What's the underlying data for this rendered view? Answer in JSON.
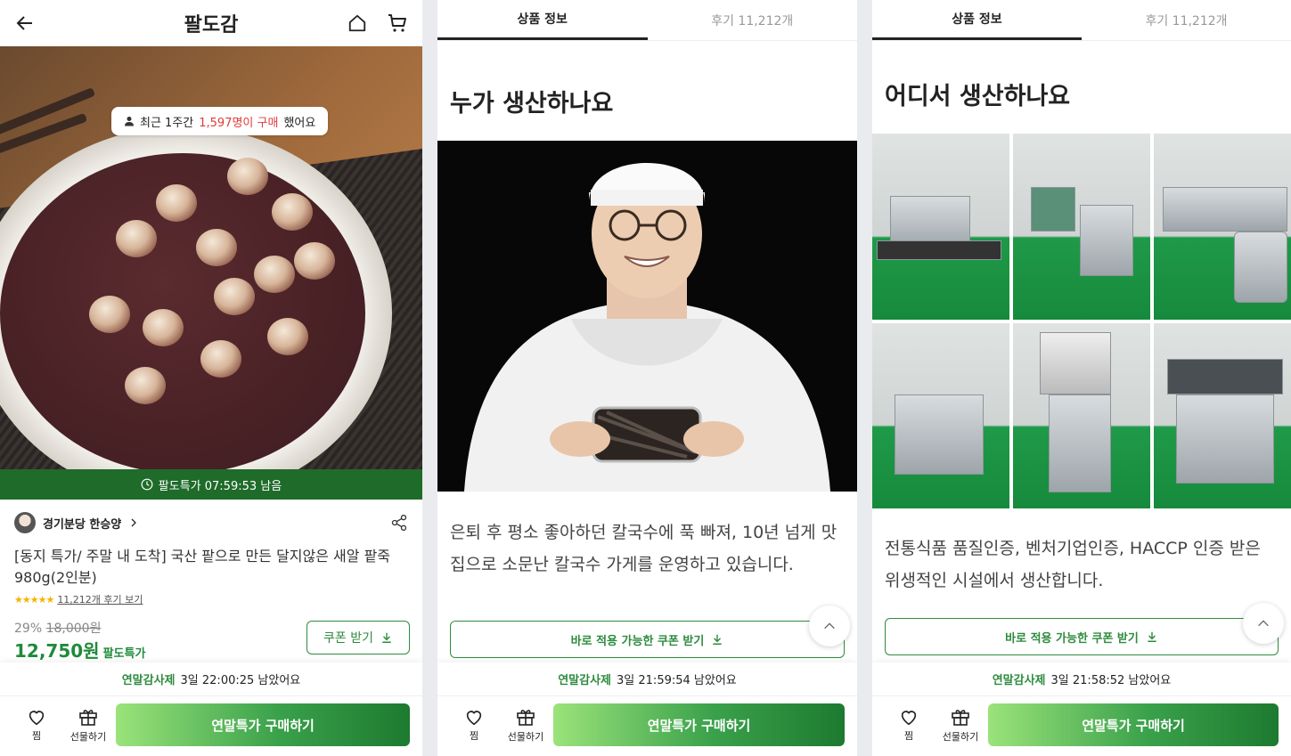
{
  "panel1": {
    "header_title": "팔도감",
    "buy_badge": {
      "prefix": "최근 1주간 ",
      "highlight": "1,597명이 구매",
      "suffix": " 했어요"
    },
    "timer": "팔도특가 07:59:53 남음",
    "seller": "경기분당 한승양",
    "product_title": "[동지 특가/ 주말 내 도착] 국산 팥으로 만든 달지않은 새알 팥죽 980g(2인분)",
    "stars": "★★★★★",
    "review_link": "11,212개 후기 보기",
    "discount_pct": "29%",
    "original_price": "18,000원",
    "price": "12,750원",
    "price_tag": "팔도특가",
    "coupon_small": "쿠폰 받기",
    "event_name": "연말감사제",
    "event_time": "3일 22:00:25 남았어요"
  },
  "panel2": {
    "tab_info": "상품 정보",
    "tab_review": "후기 11,212개",
    "heading": "누가 생산하나요",
    "desc": "은퇴 후 평소 좋아하던 칼국수에 푹 빠져, 10년 넘게 맛집으로 소문난 칼국수 가게를 운영하고 있습니다.",
    "coupon": "바로 적용 가능한 쿠폰 받기",
    "event_name": "연말감사제",
    "event_time": "3일 21:59:54 남았어요"
  },
  "panel3": {
    "tab_info": "상품 정보",
    "tab_review": "후기 11,212개",
    "heading": "어디서 생산하나요",
    "desc": "전통식품 품질인증, 벤처기업인증, HACCP 인증 받은 위생적인 시설에서 생산합니다.",
    "coupon": "바로 적용 가능한 쿠폰 받기",
    "event_name": "연말감사제",
    "event_time": "3일 21:58:52 남았어요"
  },
  "common": {
    "wish_label": "찜",
    "gift_label": "선물하기",
    "buy_label": "연말특가 구매하기"
  },
  "colors": {
    "accent_green": "#2e8b3e",
    "timer_bar": "#1f6b2a",
    "highlight_red": "#e03a3a"
  }
}
